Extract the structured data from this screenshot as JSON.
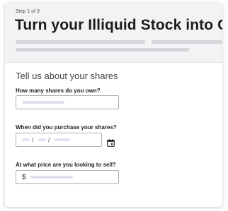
{
  "header": {
    "step": "Step 1 of 3",
    "title": "Turn your Illiquid Stock into Cash"
  },
  "form": {
    "section_title": "Tell us about your shares",
    "q_shares_label": "How many shares do you own?",
    "q_date_label": "When did you purchase your shares?",
    "date_separator": "/",
    "q_price_label": "At what price are you looking to sell?",
    "currency_symbol": "$"
  },
  "icons": {
    "calendar": "calendar-icon"
  }
}
